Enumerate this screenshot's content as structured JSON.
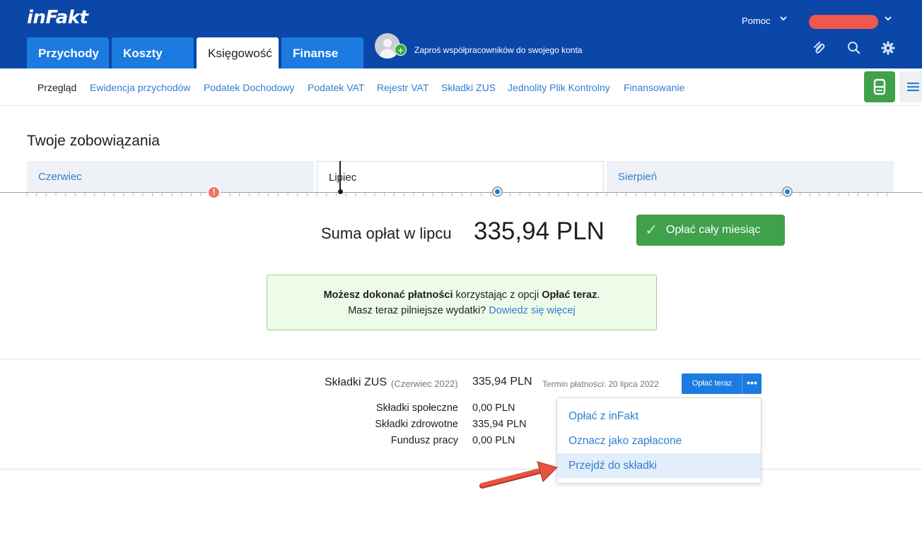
{
  "header": {
    "logo": "inFakt",
    "tabs": [
      {
        "label": "Przychody",
        "active": false
      },
      {
        "label": "Koszty",
        "active": false
      },
      {
        "label": "Księgowość",
        "active": true
      },
      {
        "label": "Finanse",
        "active": false
      }
    ],
    "invite_text": "Zaproś współpracowników do swojego konta",
    "help_label": "Pomoc",
    "user_name_redacted": true,
    "icons": [
      "paperclip-icon",
      "search-icon",
      "gear-icon"
    ]
  },
  "subnav": {
    "items": [
      {
        "label": "Przegląd",
        "current": true
      },
      {
        "label": "Ewidencja przychodów"
      },
      {
        "label": "Podatek Dochodowy"
      },
      {
        "label": "Podatek VAT"
      },
      {
        "label": "Rejestr VAT"
      },
      {
        "label": "Składki ZUS"
      },
      {
        "label": "Jednolity Plik Kontrolny"
      },
      {
        "label": "Finansowanie"
      }
    ]
  },
  "page": {
    "title": "Twoje zobowiązania",
    "months": [
      {
        "label": "Czerwiec",
        "active": false
      },
      {
        "label": "Lipiec",
        "active": true
      },
      {
        "label": "Sierpień",
        "active": false
      }
    ],
    "sum_label": "Suma opłat w lipcu",
    "sum_value": "335,94 PLN",
    "pay_month_label": "Opłać cały miesiąc",
    "info": {
      "bold1": "Możesz dokonać płatności",
      "text1": " korzystając z opcji ",
      "bold2": "Opłać teraz",
      "text2": ".",
      "line2": "Masz teraz pilniejsze wydatki? ",
      "link": "Dowiedz się więcej"
    }
  },
  "zus": {
    "title": "Składki ZUS",
    "period": "(Czerwiec 2022)",
    "amount": "335,94 PLN",
    "deadline": "Termin płatności: 20 lipca 2022",
    "pay_now_label": "Opłać teraz",
    "more_label": "•••",
    "rows": [
      {
        "label": "Składki społeczne",
        "value": "0,00 PLN"
      },
      {
        "label": "Składki zdrowotne",
        "value": "335,94 PLN"
      },
      {
        "label": "Fundusz pracy",
        "value": "0,00 PLN"
      }
    ],
    "menu": [
      {
        "label": "Opłać z inFakt"
      },
      {
        "label": "Oznacz jako zapłacone"
      },
      {
        "label": "Przejdź do składki",
        "highlighted": true
      }
    ]
  },
  "colors": {
    "header_bg": "#0b47a8",
    "tab_blue": "#1c7be0",
    "link_blue": "#2f7fd0",
    "green": "#3fa14b",
    "alert_red": "#f0584d",
    "annotation_arrow": "#e8533f"
  }
}
